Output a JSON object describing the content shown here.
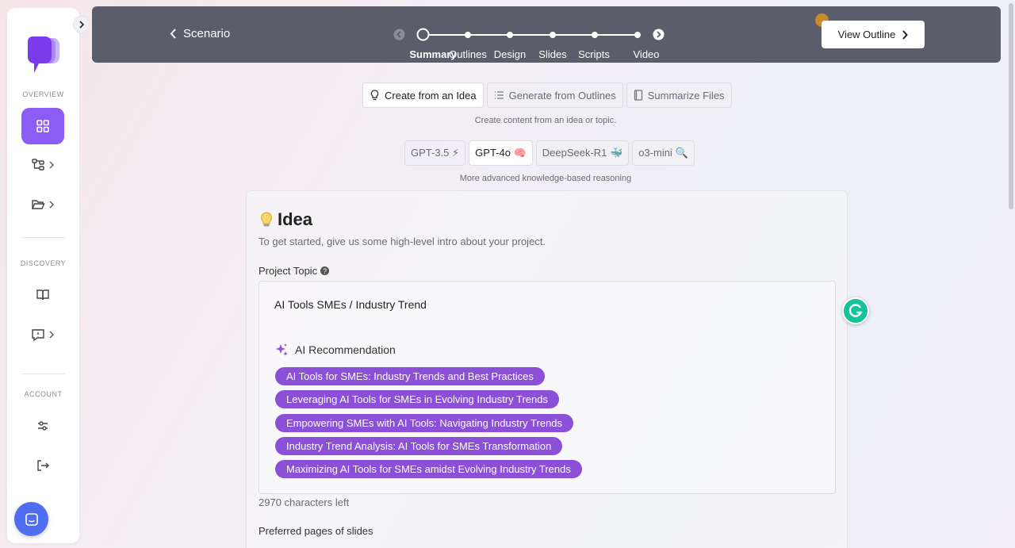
{
  "sidebar": {
    "sections": {
      "overview": "OVERVIEW",
      "discovery": "DISCOVERY",
      "account": "ACCOUNT"
    },
    "accent": "#8b5cf6"
  },
  "topbar": {
    "back_label": "Scenario",
    "steps": [
      "Summary",
      "Outlines",
      "Design",
      "Slides",
      "Scripts",
      "Video"
    ],
    "active_step": "Summary",
    "view_outline_label": "View Outline"
  },
  "modes": {
    "tabs": [
      "Create from an Idea",
      "Generate from Outlines",
      "Summarize Files"
    ],
    "active": "Create from an Idea",
    "hint": "Create content from an idea or topic."
  },
  "models": {
    "tabs": [
      "GPT-3.5 ⚡",
      "GPT-4o 🧠",
      "DeepSeek-R1 🐳",
      "o3-mini 🔍"
    ],
    "active": "GPT-4o 🧠",
    "hint": "More advanced knowledge-based reasoning"
  },
  "idea": {
    "title": "Idea",
    "subtitle": "To get started, give us some high-level intro about your project.",
    "topic_label": "Project Topic",
    "topic_value": "AI Tools SMEs / Industry Trend",
    "ai_rec_label": "AI Recommendation",
    "recommendations": [
      "AI Tools for SMEs: Industry Trends and Best Practices",
      "Leveraging AI Tools for SMEs in Evolving Industry Trends",
      "Empowering SMEs with AI Tools: Navigating Industry Trends",
      "Industry Trend Analysis: AI Tools for SMEs Transformation",
      "Maximizing AI Tools for SMEs amidst Evolving Industry Trends"
    ],
    "chars_left": "2970 characters left",
    "pages_label": "Preferred pages of slides"
  }
}
